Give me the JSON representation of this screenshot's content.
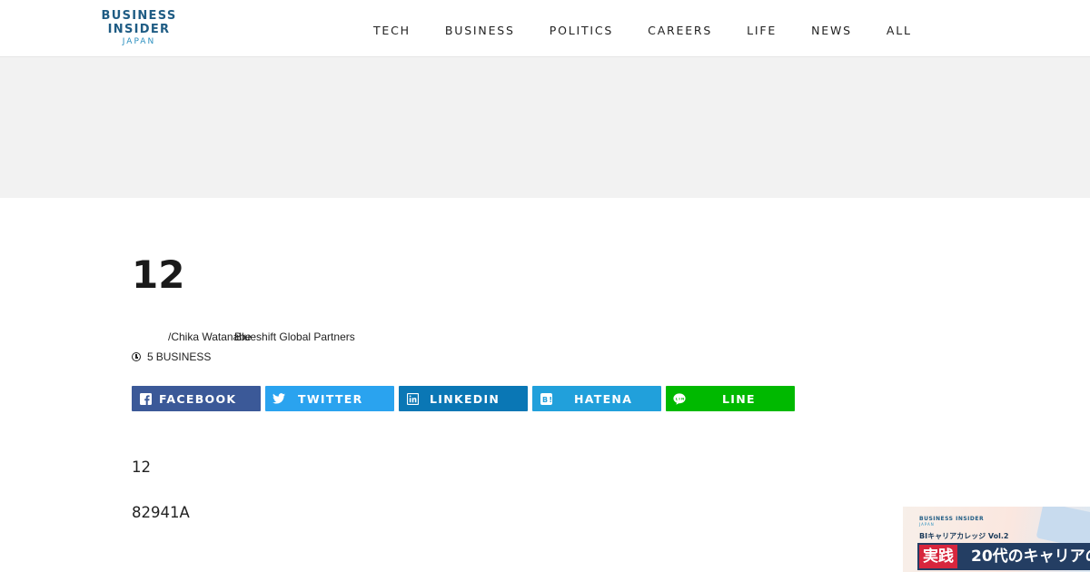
{
  "header": {
    "logo": {
      "line1": "BUSINESS",
      "line2": "INSIDER",
      "line3": "JAPAN"
    },
    "nav": [
      {
        "label": "TECH"
      },
      {
        "label": "BUSINESS"
      },
      {
        "label": "POLITICS"
      },
      {
        "label": "CAREERS"
      },
      {
        "label": "LIFE"
      },
      {
        "label": "NEWS"
      },
      {
        "label": "ALL"
      }
    ]
  },
  "article": {
    "title": "12",
    "author": "/Chika Watanabe",
    "affiliation": "Blueshift Global Partners",
    "time": "5",
    "category": "BUSINESS",
    "share": [
      {
        "label": "FACEBOOK",
        "icon": "facebook-icon",
        "color": "#3b5998"
      },
      {
        "label": "TWITTER",
        "icon": "twitter-icon",
        "color": "#2aa3ef"
      },
      {
        "label": "LINKEDIN",
        "icon": "linkedin-icon",
        "color": "#0a77b5"
      },
      {
        "label": "HATENA",
        "icon": "hatena-icon",
        "color": "#21a0db"
      },
      {
        "label": "LINE",
        "icon": "line-icon",
        "color": "#00b900"
      }
    ],
    "paragraphs": [
      "12",
      "82941A"
    ]
  },
  "float_ad": {
    "brand": "BUSINESS INSIDER",
    "brand_sub": "JAPAN",
    "subtitle": "BIキャリアカレッジ Vol.2",
    "tag": "実践",
    "headline": "20代のキャリアの"
  }
}
